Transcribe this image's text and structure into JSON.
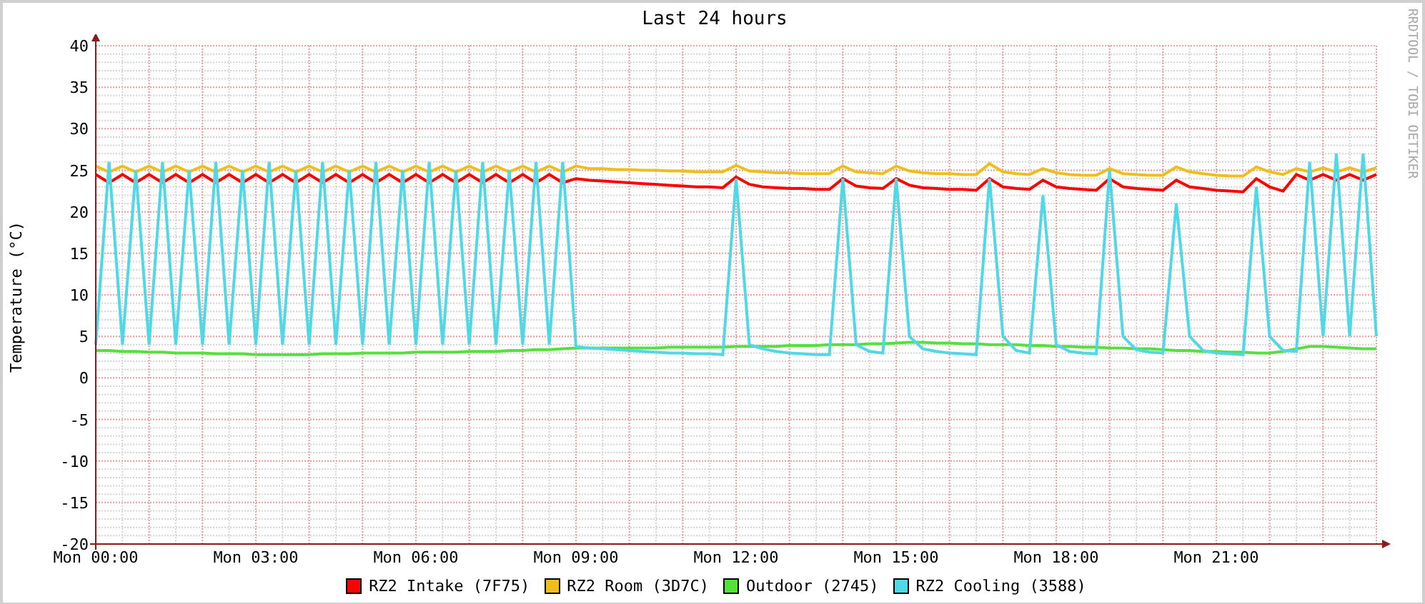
{
  "title": "Last 24 hours",
  "credit": "RRDTOOL / TOBI OETIKER",
  "chart_data": {
    "type": "line",
    "grid": true,
    "ylabel": "Temperature (°C)",
    "ylim": [
      -20,
      40
    ],
    "yticks": [
      -20,
      -15,
      -10,
      -5,
      0,
      5,
      10,
      15,
      20,
      25,
      30,
      35,
      40
    ],
    "categories": [
      "Mon 00:00",
      null,
      null,
      null,
      null,
      null,
      null,
      null,
      null,
      null,
      null,
      null,
      "Mon 03:00",
      null,
      null,
      null,
      null,
      null,
      null,
      null,
      null,
      null,
      null,
      null,
      "Mon 06:00",
      null,
      null,
      null,
      null,
      null,
      null,
      null,
      null,
      null,
      null,
      null,
      "Mon 09:00",
      null,
      null,
      null,
      null,
      null,
      null,
      null,
      null,
      null,
      null,
      null,
      "Mon 12:00",
      null,
      null,
      null,
      null,
      null,
      null,
      null,
      null,
      null,
      null,
      null,
      "Mon 15:00",
      null,
      null,
      null,
      null,
      null,
      null,
      null,
      null,
      null,
      null,
      null,
      "Mon 18:00",
      null,
      null,
      null,
      null,
      null,
      null,
      null,
      null,
      null,
      null,
      null,
      "Mon 21:00",
      null,
      null,
      null,
      null,
      null,
      null,
      null,
      null,
      null,
      null,
      null,
      null
    ],
    "series": [
      {
        "name": "RZ2 Intake (7F75)",
        "color": "#ff0000",
        "values": [
          24.5,
          23.5,
          24.5,
          23.5,
          24.5,
          23.5,
          24.5,
          23.5,
          24.5,
          23.5,
          24.5,
          23.5,
          24.5,
          23.5,
          24.5,
          23.5,
          24.5,
          23.5,
          24.5,
          23.5,
          24.5,
          23.5,
          24.5,
          23.5,
          24.5,
          23.5,
          24.5,
          23.5,
          24.5,
          23.5,
          24.5,
          23.5,
          24.5,
          23.5,
          24.5,
          23.5,
          24,
          23.8,
          23.7,
          23.6,
          23.5,
          23.4,
          23.3,
          23.2,
          23.1,
          23.0,
          23.0,
          22.9,
          24.2,
          23.3,
          23.0,
          22.9,
          22.8,
          22.8,
          22.7,
          22.7,
          24,
          23.1,
          22.9,
          22.8,
          24,
          23.2,
          22.9,
          22.8,
          22.7,
          22.7,
          22.6,
          24,
          23,
          22.8,
          22.7,
          23.8,
          23,
          22.8,
          22.7,
          22.6,
          24,
          23,
          22.8,
          22.7,
          22.6,
          23.8,
          23,
          22.8,
          22.6,
          22.5,
          22.4,
          24,
          23,
          22.5,
          24.5,
          23.8,
          24.5,
          23.8,
          24.5,
          23.8,
          24.5
        ]
      },
      {
        "name": "RZ2 Room (3D7C)",
        "color": "#eebf1c",
        "values": [
          25.5,
          24.8,
          25.5,
          24.8,
          25.5,
          24.8,
          25.5,
          24.8,
          25.5,
          24.8,
          25.5,
          24.8,
          25.5,
          24.8,
          25.5,
          24.8,
          25.5,
          24.8,
          25.5,
          24.8,
          25.5,
          24.8,
          25.5,
          24.8,
          25.5,
          24.8,
          25.5,
          24.8,
          25.5,
          24.8,
          25.5,
          24.8,
          25.5,
          24.8,
          25.5,
          24.8,
          25.5,
          25.2,
          25.2,
          25.1,
          25.1,
          25.0,
          25.0,
          24.9,
          24.9,
          24.8,
          24.8,
          24.8,
          25.6,
          24.9,
          24.8,
          24.7,
          24.7,
          24.6,
          24.6,
          24.6,
          25.5,
          24.8,
          24.7,
          24.6,
          25.5,
          24.9,
          24.7,
          24.6,
          24.6,
          24.5,
          24.5,
          25.8,
          24.8,
          24.6,
          24.5,
          25.2,
          24.7,
          24.5,
          24.4,
          24.4,
          25.2,
          24.6,
          24.5,
          24.4,
          24.4,
          25.4,
          24.8,
          24.6,
          24.4,
          24.3,
          24.3,
          25.4,
          24.8,
          24.5,
          25.2,
          24.8,
          25.3,
          24.8,
          25.3,
          24.8,
          25.3
        ]
      },
      {
        "name": "Outdoor (2745)",
        "color": "#55e03c",
        "values": [
          3.3,
          3.3,
          3.2,
          3.2,
          3.1,
          3.1,
          3.0,
          3.0,
          3.0,
          2.9,
          2.9,
          2.9,
          2.8,
          2.8,
          2.8,
          2.8,
          2.8,
          2.9,
          2.9,
          2.9,
          3.0,
          3.0,
          3.0,
          3.0,
          3.1,
          3.1,
          3.1,
          3.1,
          3.2,
          3.2,
          3.2,
          3.3,
          3.3,
          3.4,
          3.4,
          3.5,
          3.6,
          3.6,
          3.6,
          3.6,
          3.6,
          3.6,
          3.6,
          3.7,
          3.7,
          3.7,
          3.7,
          3.7,
          3.8,
          3.8,
          3.8,
          3.8,
          3.9,
          3.9,
          3.9,
          4.0,
          4.0,
          4.0,
          4.1,
          4.1,
          4.2,
          4.3,
          4.3,
          4.2,
          4.2,
          4.1,
          4.1,
          4.0,
          4.0,
          4.0,
          3.9,
          3.9,
          3.8,
          3.8,
          3.7,
          3.7,
          3.6,
          3.6,
          3.5,
          3.5,
          3.4,
          3.3,
          3.3,
          3.2,
          3.2,
          3.1,
          3.1,
          3.0,
          3.0,
          3.2,
          3.5,
          3.8,
          3.8,
          3.7,
          3.6,
          3.5,
          3.5
        ]
      },
      {
        "name": "RZ2 Cooling (3588)",
        "color": "#50d8e6",
        "values": [
          4,
          26,
          4,
          25,
          4,
          26,
          4,
          25,
          4,
          26,
          4,
          25,
          4,
          26,
          4,
          25,
          4,
          26,
          4,
          25,
          4,
          26,
          4,
          25,
          4,
          26,
          4,
          25,
          4,
          26,
          4,
          25,
          4,
          26,
          4,
          26,
          3.8,
          3.6,
          3.5,
          3.4,
          3.3,
          3.2,
          3.1,
          3.0,
          3.0,
          2.9,
          2.9,
          2.8,
          24,
          4,
          3.5,
          3.2,
          3.0,
          2.9,
          2.8,
          2.8,
          24,
          4,
          3.2,
          3.0,
          24,
          5,
          3.5,
          3.2,
          3.0,
          2.9,
          2.8,
          24,
          5,
          3.3,
          3.0,
          22,
          4,
          3.2,
          3.0,
          2.9,
          25,
          5,
          3.4,
          3.1,
          3.0,
          21,
          5,
          3.3,
          3.0,
          2.9,
          2.8,
          23,
          5,
          3.3,
          3.2,
          26,
          5,
          27,
          5,
          27,
          5
        ]
      }
    ]
  }
}
